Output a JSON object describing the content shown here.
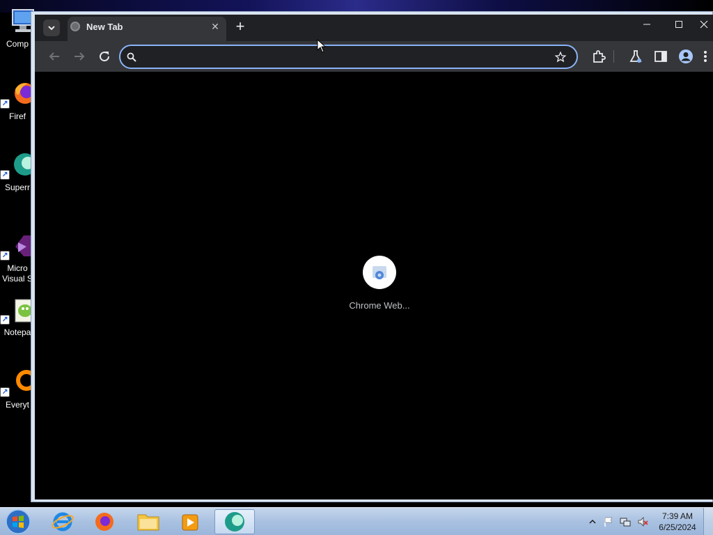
{
  "desktop": {
    "icons": [
      {
        "label_line1": "Comp",
        "label_line2": "",
        "icon": "computer-icon"
      },
      {
        "label_line1": "Firef",
        "label_line2": "",
        "icon": "firefox-icon"
      },
      {
        "label_line1": "Superr",
        "label_line2": "",
        "icon": "superray-icon"
      },
      {
        "label_line1": "Micro",
        "label_line2": "Visual S",
        "icon": "visual-studio-icon"
      },
      {
        "label_line1": "Notepa",
        "label_line2": "",
        "icon": "notepad-plus-plus-icon"
      },
      {
        "label_line1": "Everyt",
        "label_line2": "",
        "icon": "everything-search-icon"
      }
    ],
    "shortcut_glyph": "↗"
  },
  "browser": {
    "tab": {
      "title": "New Tab",
      "close_glyph": "✕"
    },
    "new_tab_glyph": "+",
    "window_controls": {
      "minimize": "—",
      "maximize": "☐",
      "close": "✕"
    },
    "omnibox": {
      "value": "",
      "placeholder": ""
    },
    "loading_label": "Chrome Web...",
    "colors": {
      "accent": "#8ab4f8",
      "frame": "#202124",
      "toolbar": "#35363a"
    }
  },
  "taskbar": {
    "apps": [
      {
        "name": "Internet Explorer",
        "icon": "internet-explorer-icon",
        "active": false
      },
      {
        "name": "Firefox",
        "icon": "firefox-icon",
        "active": false
      },
      {
        "name": "File Explorer",
        "icon": "folder-icon",
        "active": false
      },
      {
        "name": "Media Player",
        "icon": "media-player-icon",
        "active": false
      },
      {
        "name": "Superray Browser",
        "icon": "superray-icon",
        "active": true
      }
    ],
    "clock": {
      "time": "7:39 AM",
      "date": "6/25/2024"
    }
  }
}
